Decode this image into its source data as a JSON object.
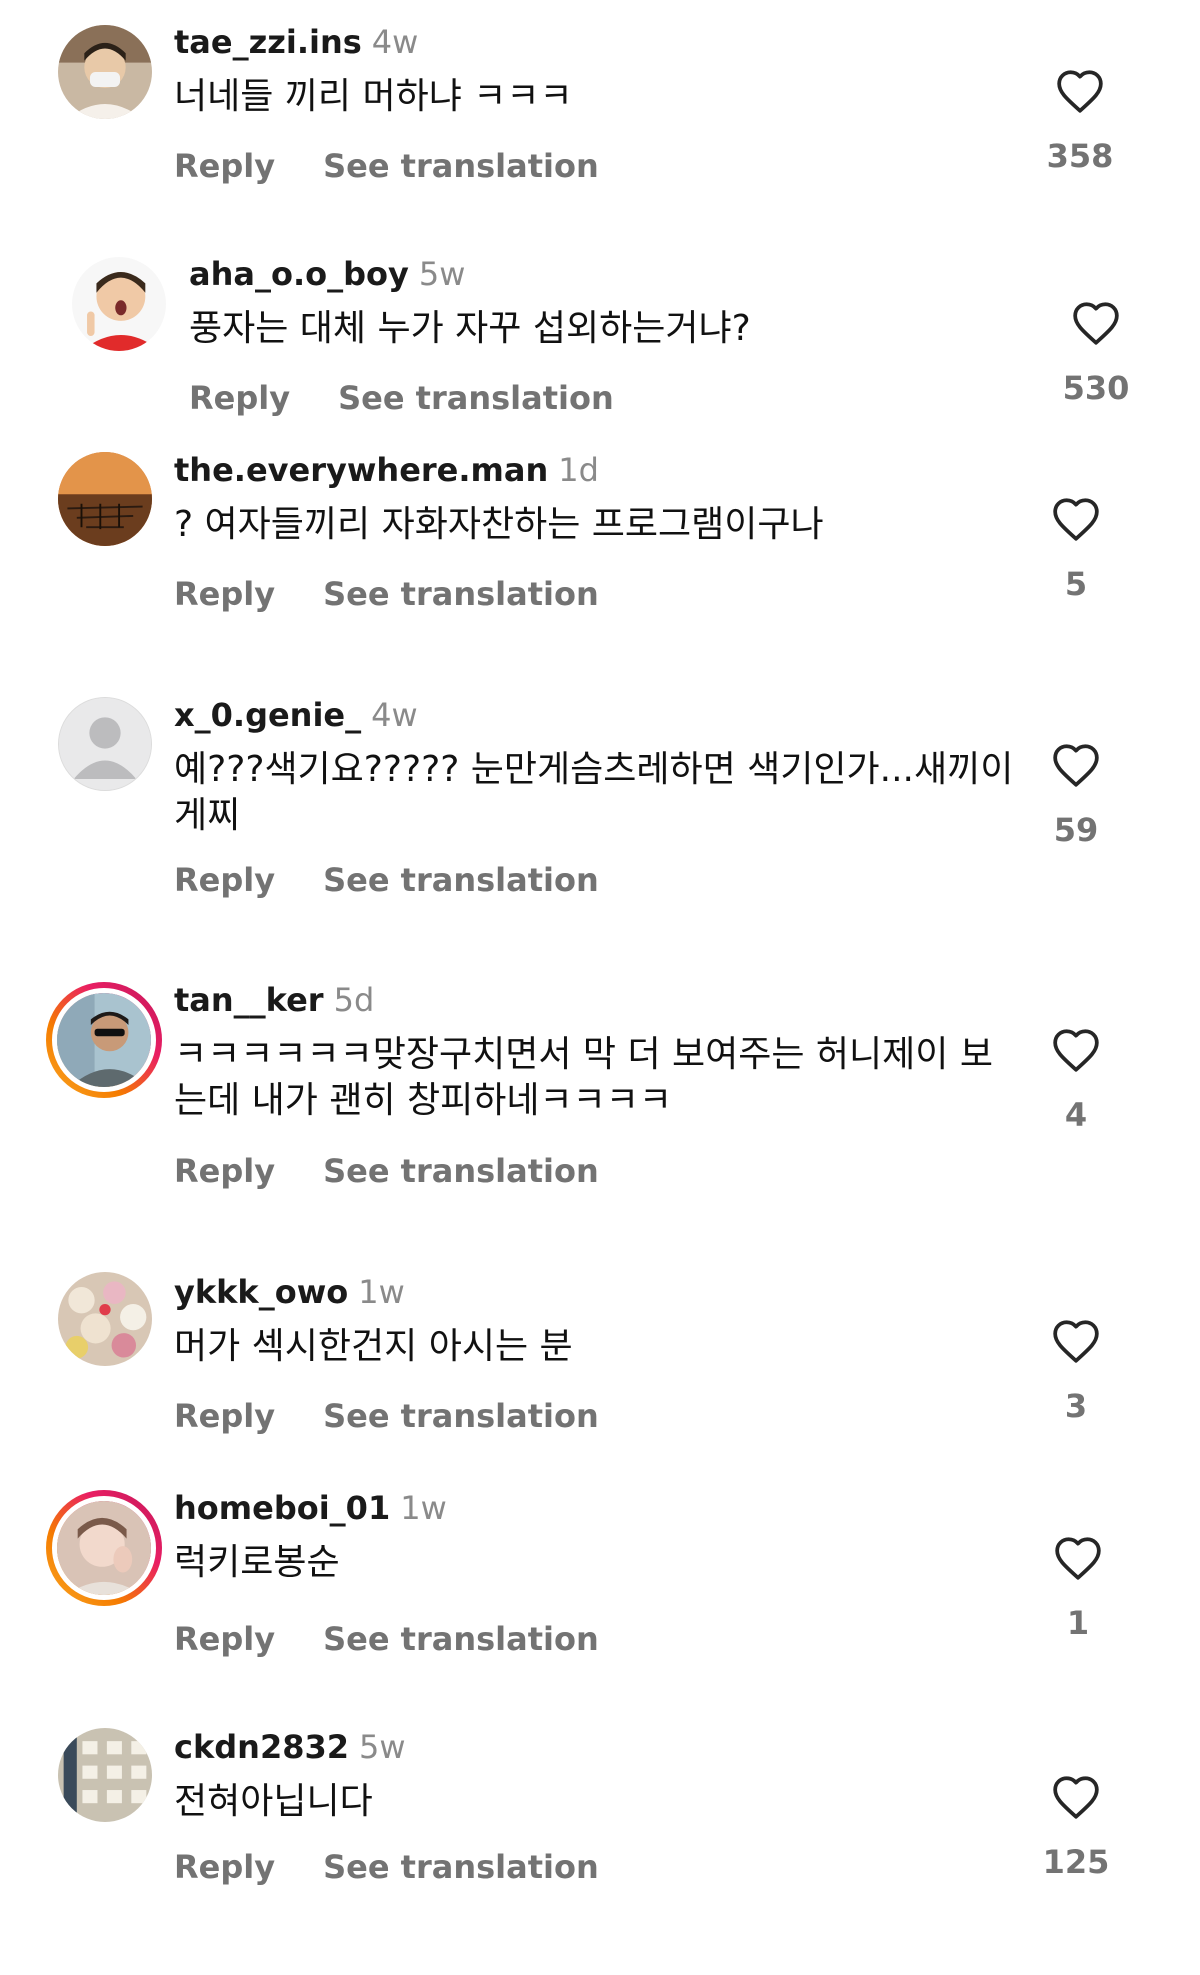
{
  "comments": [
    {
      "username": "tae_zzi.ins",
      "time": "4w",
      "text": "너네들 끼리 머하냐 ㅋㅋㅋ",
      "reply": "Reply",
      "translate": "See translation",
      "likes": "358",
      "avatar": "person-photo"
    },
    {
      "username": "aha_o.o_boy",
      "time": "5w",
      "text": "풍자는 대체 누가 자꾸 섭외하는거냐?",
      "reply": "Reply",
      "translate": "See translation",
      "likes": "530",
      "avatar": "child-photo"
    },
    {
      "username": "the.everywhere.man",
      "time": "1d",
      "text": "? 여자들끼리 자화자찬하는 프로그램이구나",
      "reply": "Reply",
      "translate": "See translation",
      "likes": "5",
      "avatar": "sunset-photo"
    },
    {
      "username": "x_0.genie_",
      "time": "4w",
      "text": "예???색기요????? 눈만게슴츠레하면 색기인가...새끼이게찌",
      "reply": "Reply",
      "translate": "See translation",
      "likes": "59",
      "avatar": "default-avatar"
    },
    {
      "username": "tan__ker",
      "time": "5d",
      "text": "ㅋㅋㅋㅋㅋㅋ맞장구치면서 막 더 보여주는 허니제이 보는데 내가 괜히 창피하네ㅋㅋㅋㅋ",
      "reply": "Reply",
      "translate": "See translation",
      "likes": "4",
      "avatar": "person-sunglasses-photo"
    },
    {
      "username": "ykkk_owo",
      "time": "1w",
      "text": "머가 섹시한건지 아시는 분",
      "reply": "Reply",
      "translate": "See translation",
      "likes": "3",
      "avatar": "plush-toys-photo"
    },
    {
      "username": "homeboi_01",
      "time": "1w",
      "text": "럭키로봉순",
      "reply": "Reply",
      "translate": "See translation",
      "likes": "1",
      "avatar": "person-photo"
    },
    {
      "username": "ckdn2832",
      "time": "5w",
      "text": "전혀아닙니다",
      "reply": "Reply",
      "translate": "See translation",
      "likes": "125",
      "avatar": "pattern-photo"
    }
  ],
  "colors": {
    "username": "#1a1a1a",
    "meta": "#737373",
    "time": "#8a8a8a",
    "story_ring": [
      "#f9a825",
      "#e91e63"
    ]
  }
}
